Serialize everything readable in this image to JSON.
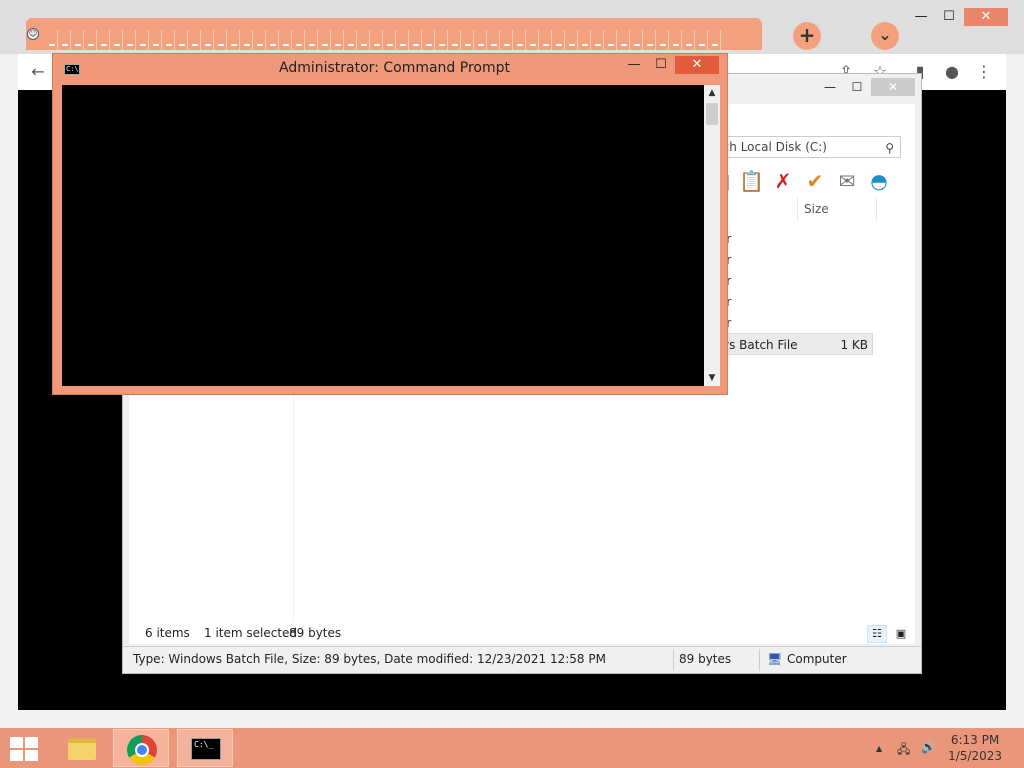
{
  "browser": {
    "favicon_glyph": "☺",
    "new_tab_glyph": "+",
    "tab_search_glyph": "⌄",
    "minimize_glyph": "—",
    "maximize_glyph": "☐",
    "close_glyph": "✕",
    "back_glyph": "←",
    "share_glyph": "⇪",
    "star_glyph": "☆",
    "sidepanel_glyph": "▮",
    "profile_glyph": "●",
    "menu_glyph": "⋮"
  },
  "explorer": {
    "minimize_glyph": "—",
    "maximize_glyph": "☐",
    "close_glyph": "✕",
    "help_glyph": "?",
    "expand_glyph": "⌄",
    "search_text": "rch Local Disk (C:)",
    "search_glyph": "⚲",
    "column_size": "Size",
    "row_fragments": [
      "er",
      "er",
      "er",
      "er",
      "er"
    ],
    "selected_row": {
      "type": "vs Batch File",
      "size": "1 KB"
    },
    "toolbar_glyphs": {
      "page": "▯",
      "clipboard": "📋",
      "delete": "✗",
      "check": "✔",
      "mail": "✉",
      "shell": "◓"
    },
    "status": {
      "items": "6 items",
      "selected": "1 item selected",
      "bytes": "89 bytes"
    },
    "view_glyphs": {
      "details": "☷",
      "preview": "▣"
    },
    "details_bar": {
      "info": "Type: Windows Batch File, Size: 89 bytes, Date modified: 12/23/2021 12:58 PM",
      "size": "89 bytes",
      "location": "Computer",
      "location_glyph": "🖥"
    }
  },
  "cmd": {
    "title": "Administrator:  Command Prompt",
    "icon_text": "C:\\",
    "minimize_glyph": "—",
    "maximize_glyph": "☐",
    "close_glyph": "✕",
    "scroll_up_glyph": "▲",
    "scroll_down_glyph": "▼"
  },
  "taskbar": {
    "cmd_icon_text": "C:\\_",
    "tray_arrow": "▲",
    "network_glyph": "🖧",
    "volume_glyph": "🔊",
    "time": "6:13 PM",
    "date": "1/5/2023"
  }
}
